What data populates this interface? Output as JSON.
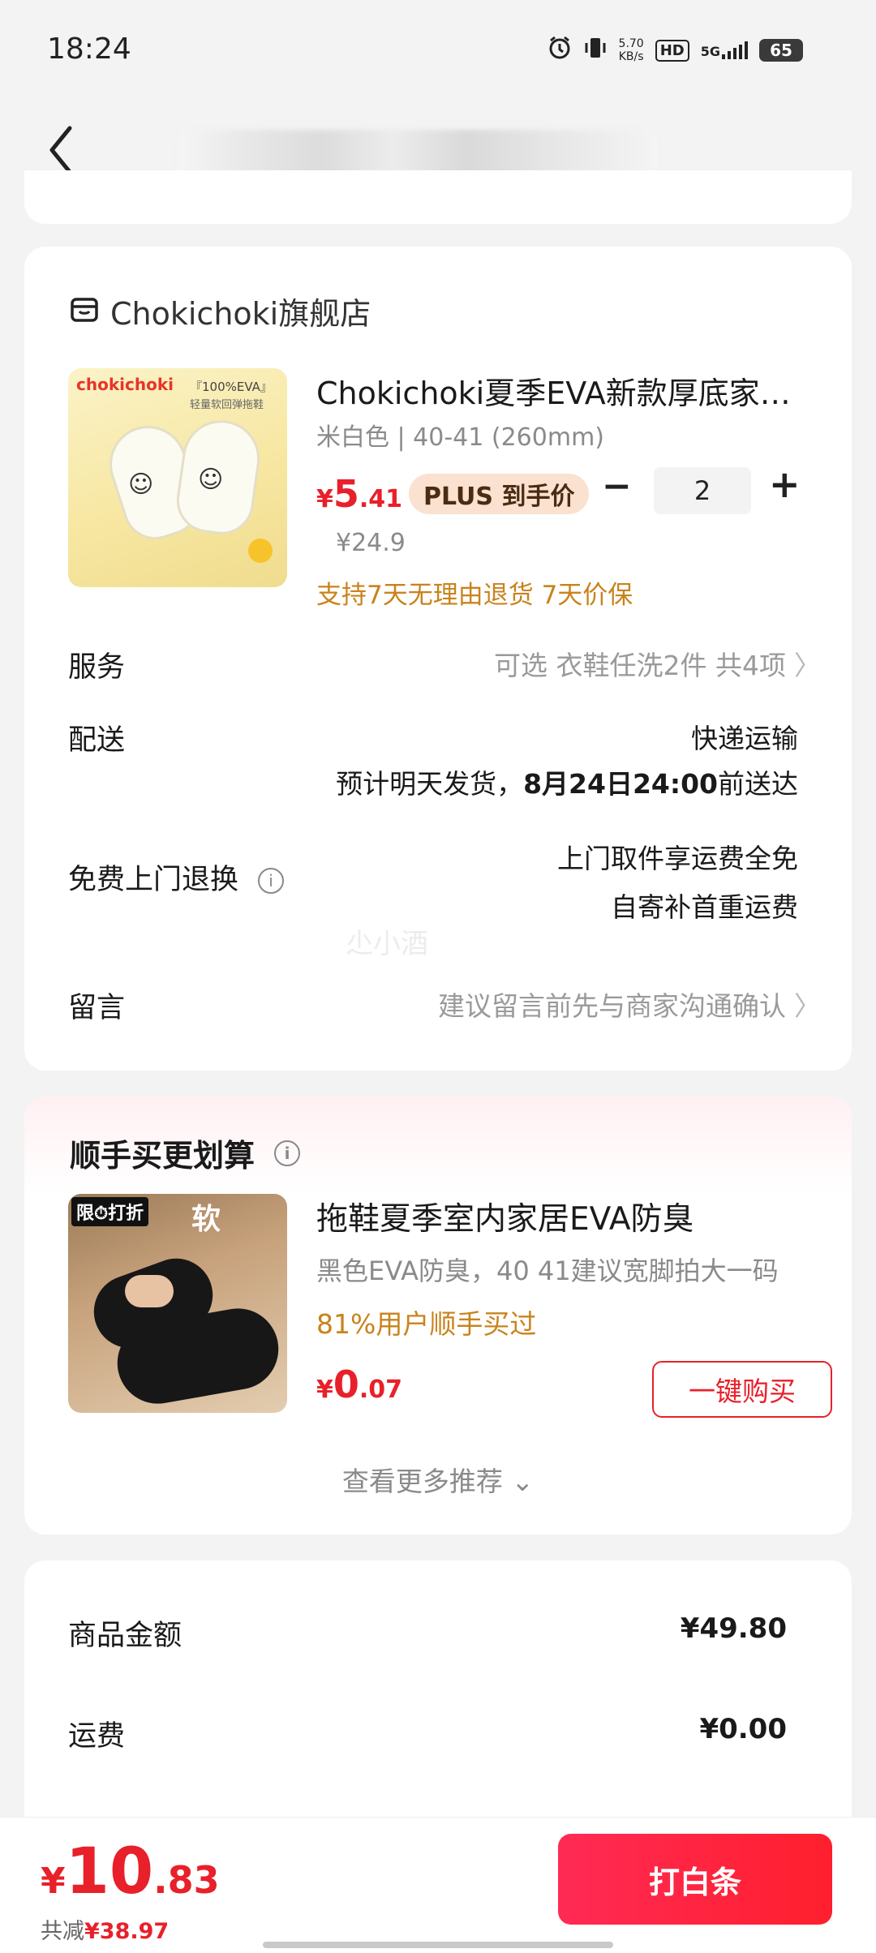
{
  "status_bar": {
    "time": "18:24",
    "net_speed_value": "5.70",
    "net_speed_unit": "KB/s",
    "hd": "HD",
    "network": "5G",
    "battery": "65"
  },
  "order": {
    "shop_name": "Chokichoki旗舰店",
    "product": {
      "title": "Chokichoki夏季EVA新款厚底家居拖鞋",
      "spec": "米白色 | 40-41 (260mm)",
      "price_symbol": "¥",
      "price_int": "5",
      "price_dec": ".41",
      "plus_label": "PLUS 到手价",
      "original_price": "¥24.9",
      "quantity": "2",
      "minus": "−",
      "plus": "+",
      "guarantee": "支持7天无理由退货  7天价保",
      "thumb_brand": "chokichoki",
      "thumb_tag": "『100%EVA』",
      "thumb_sub": "轻量软回弹拖鞋"
    },
    "service": {
      "label": "服务",
      "value": "可选  衣鞋任洗2件  共4项"
    },
    "delivery": {
      "label": "配送",
      "method": "快递运输",
      "estimate_prefix": "预计明天发货，",
      "estimate_date": "8月24日24:00",
      "estimate_suffix": "前送达"
    },
    "return": {
      "label": "免费上门退换",
      "line1": "上门取件享运费全免",
      "line2": "自寄补首重运费"
    },
    "note": {
      "label": "留言",
      "placeholder": "建议留言前先与商家沟通确认"
    },
    "watermark": "尐小酒"
  },
  "recommend": {
    "title": "顺手买更划算",
    "item": {
      "name": "拖鞋夏季室内家居EVA防臭",
      "spec": "黑色EVA防臭，40 41建议宽脚拍大一码",
      "bought": "81%用户顺手买过",
      "price_symbol": "¥",
      "price_int": "0",
      "price_dec": ".07",
      "buy_label": "一键购买",
      "badge_limit": "限⏱打折",
      "badge_soft": "软"
    },
    "more": "查看更多推荐"
  },
  "summary": {
    "goods_label": "商品金额",
    "goods_value": "¥49.80",
    "shipping_label": "运费",
    "shipping_value": "¥0.00"
  },
  "footer": {
    "total_symbol": "¥",
    "total_int": "10",
    "total_dec": ".83",
    "saved_label": "共减",
    "saved_value": "¥38.97",
    "pay_label": "打白条"
  },
  "colors": {
    "accent": "#e8202a",
    "gold": "#c9831c",
    "pay_gradient": "#ff2a55"
  }
}
